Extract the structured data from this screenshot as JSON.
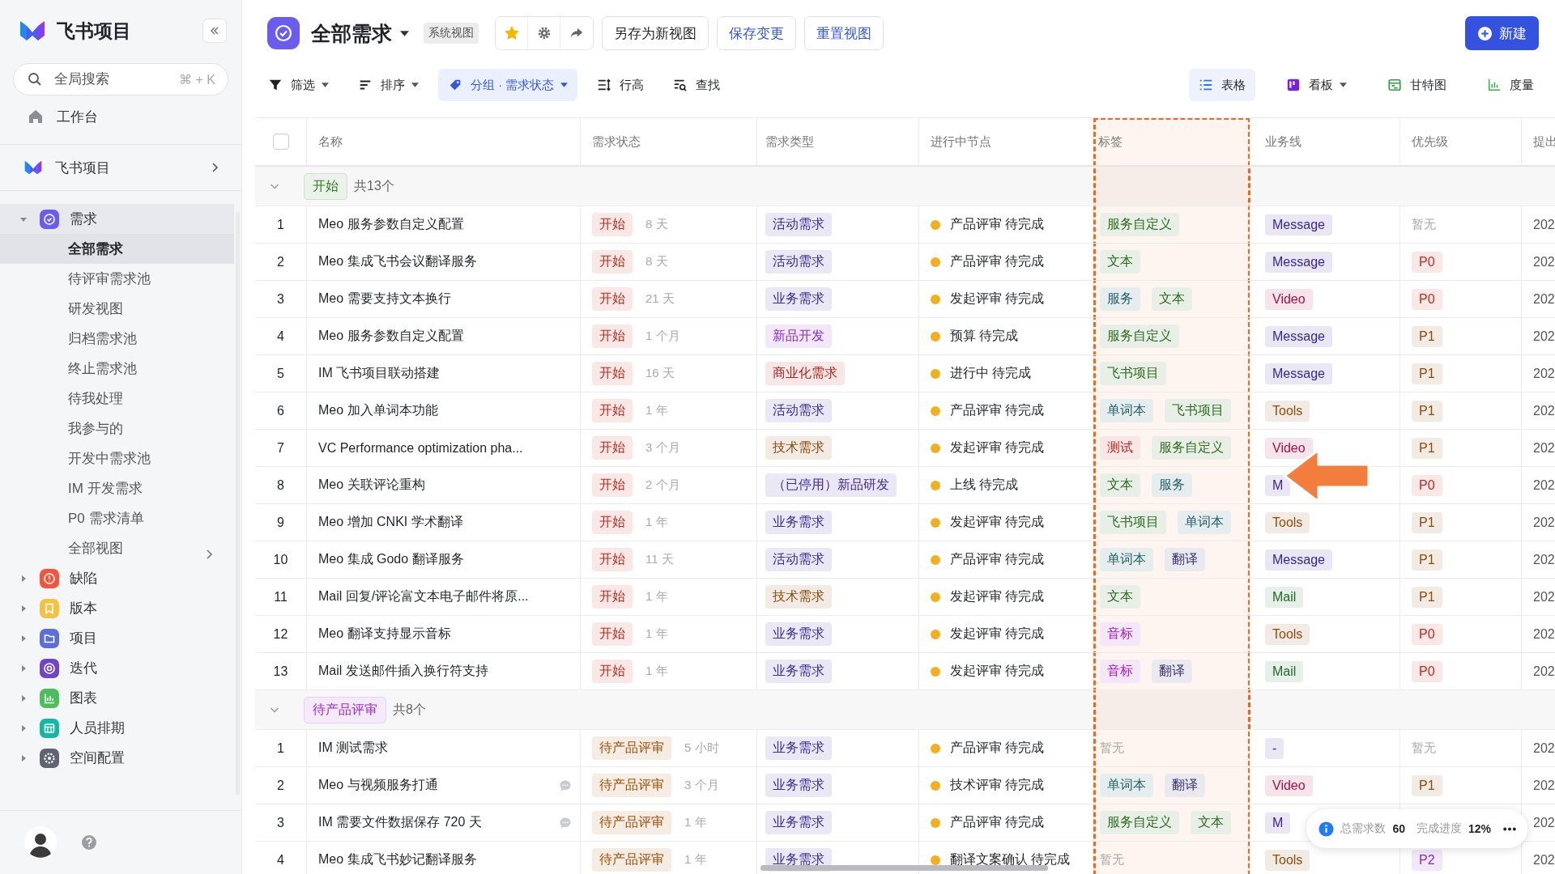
{
  "sidebar": {
    "app_title": "飞书项目",
    "search": {
      "placeholder": "全局搜索",
      "shortcut": "⌘ + K"
    },
    "workbench": "工作台",
    "space": "飞书项目",
    "nav": [
      {
        "label": "需求",
        "kind": "requirement",
        "color": "#6b5cf0",
        "expanded": true,
        "selected": true,
        "children": [
          {
            "label": "全部需求",
            "selected": true,
            "kind": "view"
          },
          {
            "label": "待评审需求池",
            "selected": false,
            "kind": "view"
          },
          {
            "label": "研发视图",
            "selected": false,
            "kind": "view"
          },
          {
            "label": "归档需求池",
            "selected": false,
            "kind": "view"
          },
          {
            "label": "终止需求池",
            "selected": false,
            "kind": "view"
          },
          {
            "label": "待我处理",
            "selected": false,
            "kind": "view"
          },
          {
            "label": "我参与的",
            "selected": false,
            "kind": "view"
          },
          {
            "label": "开发中需求池",
            "selected": false,
            "kind": "view"
          },
          {
            "label": "IM 开发需求",
            "selected": false,
            "kind": "view"
          },
          {
            "label": "P0 需求清单",
            "selected": false,
            "kind": "view"
          },
          {
            "label": "全部视图",
            "selected": false,
            "kind": "more"
          }
        ]
      },
      {
        "label": "缺陷",
        "kind": "defect",
        "color": "#f4553b",
        "expanded": false,
        "selected": false
      },
      {
        "label": "版本",
        "kind": "version",
        "color": "#f5c243",
        "expanded": false,
        "selected": false
      },
      {
        "label": "项目",
        "kind": "project",
        "color": "#5b6fd6",
        "expanded": false,
        "selected": false
      },
      {
        "label": "迭代",
        "kind": "iteration",
        "color": "#7046c7",
        "expanded": false,
        "selected": false
      },
      {
        "label": "图表",
        "kind": "chart",
        "color": "#4cbf5a",
        "expanded": false,
        "selected": false
      },
      {
        "label": "人员排期",
        "kind": "schedule",
        "color": "#14b8a0",
        "expanded": false,
        "selected": false
      },
      {
        "label": "空间配置",
        "kind": "settings",
        "color": "#5f6470",
        "expanded": false,
        "selected": false
      }
    ]
  },
  "header": {
    "title": "全部需求",
    "view_badge": "系统视图",
    "starred": true,
    "buttons": [
      {
        "kind": "plain",
        "label": "另存为新视图"
      },
      {
        "kind": "link",
        "label": "保存变更"
      },
      {
        "kind": "link",
        "label": "重置视图"
      }
    ],
    "new_button": "新建"
  },
  "toolbar": {
    "left": [
      {
        "kind": "filter",
        "label": "筛选",
        "dropdown": true,
        "selected": false
      },
      {
        "kind": "sort",
        "label": "排序",
        "dropdown": true,
        "selected": false
      },
      {
        "kind": "group",
        "label": "分组 · 需求状态",
        "dropdown": true,
        "selected": true
      },
      {
        "kind": "row_height",
        "label": "行高",
        "dropdown": false,
        "selected": false
      },
      {
        "kind": "find",
        "label": "查找",
        "dropdown": false,
        "selected": false
      }
    ],
    "views": [
      {
        "kind": "table",
        "label": "表格",
        "dropdown": false,
        "selected": true
      },
      {
        "kind": "board",
        "label": "看板",
        "dropdown": true,
        "selected": false
      },
      {
        "kind": "gantt",
        "label": "甘特图",
        "dropdown": false,
        "selected": false
      },
      {
        "kind": "metrics",
        "label": "度量",
        "dropdown": false,
        "selected": false
      }
    ]
  },
  "table": {
    "select_all": {
      "checked": false
    },
    "columns": [
      "名称",
      "需求状态",
      "需求类型",
      "进行中节点",
      "标签",
      "业务线",
      "优先级",
      "提出"
    ],
    "groups": [
      {
        "status": {
          "text": "开始",
          "color": "#2f7d22"
        },
        "count": "共13个",
        "expanded": true,
        "rows": [
          {
            "index": "1",
            "name": "Meo 服务参数自定义配置",
            "comment": false,
            "status": {
              "kind": "tag",
              "text": "开始",
              "color": "#c62a1e"
            },
            "age": "8 天",
            "type": {
              "kind": "tag",
              "text": "活动需求",
              "color": "#3f2a9a"
            },
            "node": "产品评审 待完成",
            "tags": [
              {
                "kind": "tag",
                "text": "服务自定义",
                "color": "#2e6b1f"
              }
            ],
            "business": {
              "kind": "tag",
              "text": "Message",
              "color": "#3a2596"
            },
            "priority": {
              "kind": "empty",
              "text": "暂无"
            },
            "column_9": "202"
          },
          {
            "index": "2",
            "name": "Meo 集成飞书会议翻译服务",
            "comment": false,
            "status": {
              "kind": "tag",
              "text": "开始",
              "color": "#c62a1e"
            },
            "age": "8 天",
            "type": {
              "kind": "tag",
              "text": "活动需求",
              "color": "#3f2a9a"
            },
            "node": "产品评审 待完成",
            "tags": [
              {
                "kind": "tag",
                "text": "文本",
                "color": "#2e6b1f"
              }
            ],
            "business": {
              "kind": "tag",
              "text": "Message",
              "color": "#3a2596"
            },
            "priority": {
              "kind": "tag",
              "text": "P0",
              "color": "#c62a1e"
            },
            "column_9": "202"
          },
          {
            "index": "3",
            "name": "Meo 需要支持文本换行",
            "comment": false,
            "status": {
              "kind": "tag",
              "text": "开始",
              "color": "#c62a1e"
            },
            "age": "21 天",
            "type": {
              "kind": "tag",
              "text": "业务需求",
              "color": "#3f2a9a"
            },
            "node": "发起评审 待完成",
            "tags": [
              {
                "kind": "tag",
                "text": "服务",
                "color": "#1f5f63"
              },
              {
                "kind": "tag",
                "text": "文本",
                "color": "#2e6b1f"
              }
            ],
            "business": {
              "kind": "tag",
              "text": "Video",
              "color": "#a3104a"
            },
            "priority": {
              "kind": "tag",
              "text": "P0",
              "color": "#c62a1e"
            },
            "column_9": "202"
          },
          {
            "index": "4",
            "name": "Meo 服务参数自定义配置",
            "comment": false,
            "status": {
              "kind": "tag",
              "text": "开始",
              "color": "#c62a1e"
            },
            "age": "1 个月",
            "type": {
              "kind": "tag",
              "text": "新品开发",
              "color": "#8a2bd1"
            },
            "node": "预算 待完成",
            "tags": [
              {
                "kind": "tag",
                "text": "服务自定义",
                "color": "#2e6b1f"
              }
            ],
            "business": {
              "kind": "tag",
              "text": "Message",
              "color": "#3a2596"
            },
            "priority": {
              "kind": "tag",
              "text": "P1",
              "color": "#8a4b0b"
            },
            "column_9": "202"
          },
          {
            "index": "5",
            "name": "IM 飞书项目联动搭建",
            "comment": false,
            "status": {
              "kind": "tag",
              "text": "开始",
              "color": "#c62a1e"
            },
            "age": "16 天",
            "type": {
              "kind": "tag",
              "text": "商业化需求",
              "color": "#b3261e"
            },
            "node": "进行中 待完成",
            "tags": [
              {
                "kind": "tag",
                "text": "飞书项目",
                "color": "#2e6b1f"
              }
            ],
            "business": {
              "kind": "tag",
              "text": "Message",
              "color": "#3a2596"
            },
            "priority": {
              "kind": "tag",
              "text": "P1",
              "color": "#8a4b0b"
            },
            "column_9": "202"
          },
          {
            "index": "6",
            "name": "Meo 加入单词本功能",
            "comment": false,
            "status": {
              "kind": "tag",
              "text": "开始",
              "color": "#c62a1e"
            },
            "age": "1 年",
            "type": {
              "kind": "tag",
              "text": "活动需求",
              "color": "#3f2a9a"
            },
            "node": "产品评审 待完成",
            "tags": [
              {
                "kind": "tag",
                "text": "单词本",
                "color": "#1f5f63"
              },
              {
                "kind": "tag",
                "text": "飞书项目",
                "color": "#2e6b1f"
              }
            ],
            "business": {
              "kind": "tag",
              "text": "Tools",
              "color": "#8a4b0b"
            },
            "priority": {
              "kind": "tag",
              "text": "P1",
              "color": "#8a4b0b"
            },
            "column_9": "202"
          },
          {
            "index": "7",
            "name": "VC Performance optimization pha...",
            "comment": false,
            "status": {
              "kind": "tag",
              "text": "开始",
              "color": "#c62a1e"
            },
            "age": "3 个月",
            "type": {
              "kind": "tag",
              "text": "技术需求",
              "color": "#8a4b0b"
            },
            "node": "发起评审 待完成",
            "tags": [
              {
                "kind": "tag",
                "text": "测试",
                "color": "#c2261a"
              },
              {
                "kind": "tag",
                "text": "服务自定义",
                "color": "#2e6b1f"
              }
            ],
            "business": {
              "kind": "tag",
              "text": "Video",
              "color": "#a3104a"
            },
            "priority": {
              "kind": "tag",
              "text": "P1",
              "color": "#8a4b0b"
            },
            "column_9": "202"
          },
          {
            "index": "8",
            "name": "Meo 关联评论重构",
            "comment": false,
            "status": {
              "kind": "tag",
              "text": "开始",
              "color": "#c62a1e"
            },
            "age": "2 个月",
            "type": {
              "kind": "tag",
              "text": "（已停用）新品研发",
              "color": "#3f2a9a"
            },
            "node": "上线 待完成",
            "tags": [
              {
                "kind": "tag",
                "text": "文本",
                "color": "#2e6b1f"
              },
              {
                "kind": "tag",
                "text": "服务",
                "color": "#1f5f63"
              }
            ],
            "business": {
              "kind": "tag",
              "text": "M",
              "color": "#3a2596"
            },
            "priority": {
              "kind": "tag",
              "text": "P0",
              "color": "#c62a1e"
            },
            "column_9": "202"
          },
          {
            "index": "9",
            "name": "Meo 增加 CNKI 学术翻译",
            "comment": false,
            "status": {
              "kind": "tag",
              "text": "开始",
              "color": "#c62a1e"
            },
            "age": "1 年",
            "type": {
              "kind": "tag",
              "text": "业务需求",
              "color": "#3f2a9a"
            },
            "node": "发起评审 待完成",
            "tags": [
              {
                "kind": "tag",
                "text": "飞书项目",
                "color": "#2e6b1f"
              },
              {
                "kind": "tag",
                "text": "单词本",
                "color": "#1f5f63"
              }
            ],
            "business": {
              "kind": "tag",
              "text": "Tools",
              "color": "#8a4b0b"
            },
            "priority": {
              "kind": "tag",
              "text": "P1",
              "color": "#8a4b0b"
            },
            "column_9": "202"
          },
          {
            "index": "10",
            "name": "Meo 集成 Godo 翻译服务",
            "comment": false,
            "status": {
              "kind": "tag",
              "text": "开始",
              "color": "#c62a1e"
            },
            "age": "11 天",
            "type": {
              "kind": "tag",
              "text": "活动需求",
              "color": "#3f2a9a"
            },
            "node": "产品评审 待完成",
            "tags": [
              {
                "kind": "tag",
                "text": "单词本",
                "color": "#1f5f63"
              },
              {
                "kind": "tag",
                "text": "翻译",
                "color": "#3a3370"
              }
            ],
            "business": {
              "kind": "tag",
              "text": "Message",
              "color": "#3a2596"
            },
            "priority": {
              "kind": "tag",
              "text": "P1",
              "color": "#8a4b0b"
            },
            "column_9": "202"
          },
          {
            "index": "11",
            "name": "Mail 回复/评论富文本电子邮件将原...",
            "comment": false,
            "status": {
              "kind": "tag",
              "text": "开始",
              "color": "#c62a1e"
            },
            "age": "1 年",
            "type": {
              "kind": "tag",
              "text": "技术需求",
              "color": "#8a4b0b"
            },
            "node": "发起评审 待完成",
            "tags": [
              {
                "kind": "tag",
                "text": "文本",
                "color": "#2e6b1f"
              }
            ],
            "business": {
              "kind": "tag",
              "text": "Mail",
              "color": "#1f6b2a"
            },
            "priority": {
              "kind": "tag",
              "text": "P1",
              "color": "#8a4b0b"
            },
            "column_9": "202"
          },
          {
            "index": "12",
            "name": "Meo 翻译支持显示音标",
            "comment": false,
            "status": {
              "kind": "tag",
              "text": "开始",
              "color": "#c62a1e"
            },
            "age": "1 年",
            "type": {
              "kind": "tag",
              "text": "业务需求",
              "color": "#3f2a9a"
            },
            "node": "发起评审 待完成",
            "tags": [
              {
                "kind": "tag",
                "text": "音标",
                "color": "#a020c8"
              }
            ],
            "business": {
              "kind": "tag",
              "text": "Tools",
              "color": "#8a4b0b"
            },
            "priority": {
              "kind": "tag",
              "text": "P0",
              "color": "#c62a1e"
            },
            "column_9": "202"
          },
          {
            "index": "13",
            "name": "Mail 发送邮件插入换行符支持",
            "comment": false,
            "status": {
              "kind": "tag",
              "text": "开始",
              "color": "#c62a1e"
            },
            "age": "1 年",
            "type": {
              "kind": "tag",
              "text": "业务需求",
              "color": "#3f2a9a"
            },
            "node": "发起评审 待完成",
            "tags": [
              {
                "kind": "tag",
                "text": "音标",
                "color": "#a020c8"
              },
              {
                "kind": "tag",
                "text": "翻译",
                "color": "#3a3370"
              }
            ],
            "business": {
              "kind": "tag",
              "text": "Mail",
              "color": "#1f6b2a"
            },
            "priority": {
              "kind": "tag",
              "text": "P0",
              "color": "#c62a1e"
            },
            "column_9": "202"
          }
        ]
      },
      {
        "status": {
          "text": "待产品评审",
          "color": "#9b2fc9"
        },
        "count": "共8个",
        "expanded": true,
        "rows": [
          {
            "index": "1",
            "name": "IM 测试需求",
            "comment": false,
            "status": {
              "kind": "tag",
              "text": "待产品评审",
              "color": "#a0520a"
            },
            "age": "5 小时",
            "type": {
              "kind": "tag",
              "text": "业务需求",
              "color": "#3f2a9a"
            },
            "node": "产品评审 待完成",
            "tags": [
              {
                "kind": "empty",
                "text": "暂无"
              }
            ],
            "business": {
              "kind": "tag",
              "text": "-",
              "color": "#3a2596"
            },
            "priority": {
              "kind": "empty",
              "text": "暂无"
            },
            "column_9": "202"
          },
          {
            "index": "2",
            "name": "Meo 与视频服务打通",
            "comment": true,
            "status": {
              "kind": "tag",
              "text": "待产品评审",
              "color": "#a0520a"
            },
            "age": "3 个月",
            "type": {
              "kind": "tag",
              "text": "业务需求",
              "color": "#3f2a9a"
            },
            "node": "技术评审 待完成",
            "tags": [
              {
                "kind": "tag",
                "text": "单词本",
                "color": "#1f5f63"
              },
              {
                "kind": "tag",
                "text": "翻译",
                "color": "#3a3370"
              }
            ],
            "business": {
              "kind": "tag",
              "text": "Video",
              "color": "#a3104a"
            },
            "priority": {
              "kind": "tag",
              "text": "P1",
              "color": "#8a4b0b"
            },
            "column_9": "202"
          },
          {
            "index": "3",
            "name": "IM 需要文件数据保存 720 天",
            "comment": true,
            "status": {
              "kind": "tag",
              "text": "待产品评审",
              "color": "#a0520a"
            },
            "age": "1 年",
            "type": {
              "kind": "tag",
              "text": "业务需求",
              "color": "#3f2a9a"
            },
            "node": "产品评审 待完成",
            "tags": [
              {
                "kind": "tag",
                "text": "服务自定义",
                "color": "#2e6b1f"
              },
              {
                "kind": "tag",
                "text": "文本",
                "color": "#2e6b1f"
              }
            ],
            "business": {
              "kind": "tag",
              "text": "M",
              "color": "#3a2596"
            },
            "column_9": "202"
          },
          {
            "index": "4",
            "name": "Meo 集成飞书妙记翻译服务",
            "comment": false,
            "status": {
              "kind": "tag",
              "text": "待产品评审",
              "color": "#a0520a"
            },
            "age": "1 年",
            "type": {
              "kind": "tag",
              "text": "业务需求",
              "color": "#3f2a9a"
            },
            "node": "翻译文案确认 待完成",
            "tags": [
              {
                "kind": "empty",
                "text": "暂无"
              }
            ],
            "business": {
              "kind": "tag",
              "text": "Tools",
              "color": "#8a4b0b"
            },
            "priority": {
              "kind": "tag",
              "text": "P2",
              "color": "#8a2bd1"
            },
            "column_9": "202"
          }
        ]
      }
    ]
  },
  "summary": {
    "total_label": "总需求数",
    "total": "60",
    "progress_label": "完成进度",
    "progress": "12%"
  }
}
